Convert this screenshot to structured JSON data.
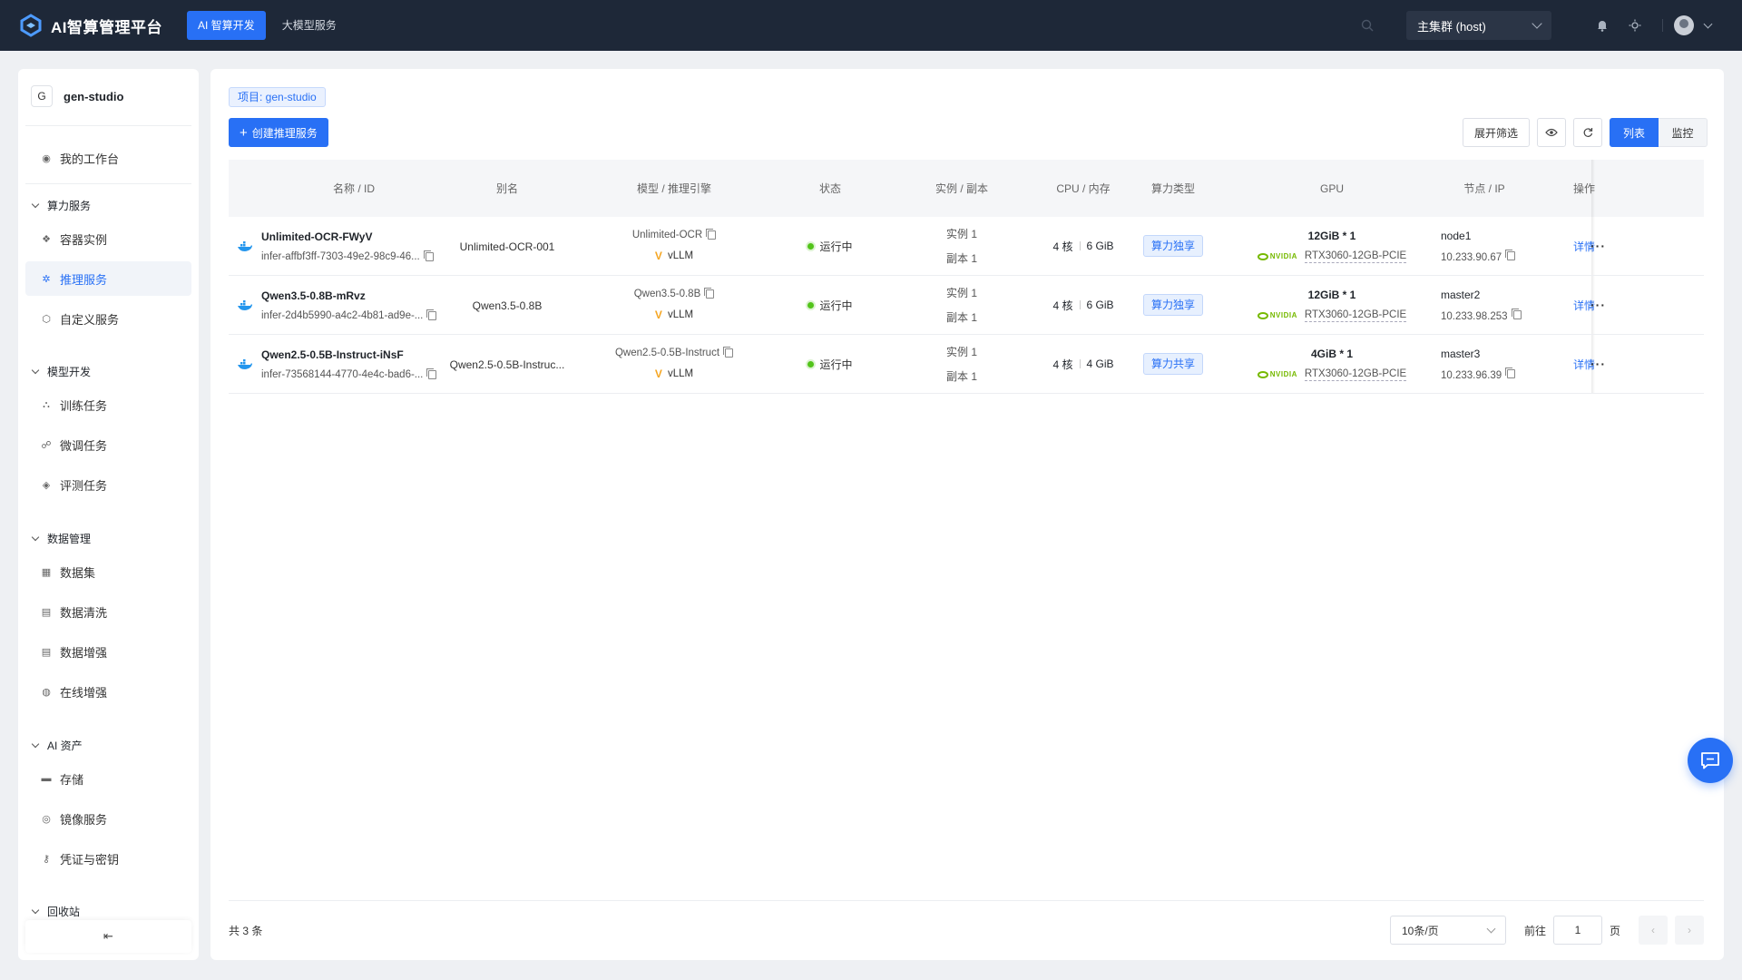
{
  "app": {
    "title": "AI智算管理平台"
  },
  "nav": {
    "tabs": [
      {
        "label": "AI 智算开发"
      },
      {
        "label": "大模型服务"
      }
    ]
  },
  "topbar": {
    "cluster": "主集群 (host)"
  },
  "sidebar": {
    "project_initial": "G",
    "project_name": "gen-studio",
    "workspace": "我的工作台",
    "groups": {
      "compute": "算力服务",
      "model_dev": "模型开发",
      "data": "数据管理",
      "ai_assets": "AI 资产",
      "recycle": "回收站"
    },
    "items": {
      "container": "容器实例",
      "inference": "推理服务",
      "custom": "自定义服务",
      "training": "训练任务",
      "finetune": "微调任务",
      "eval": "评测任务",
      "dataset": "数据集",
      "cleaning": "数据清洗",
      "augment": "数据增强",
      "online_augment": "在线增强",
      "storage": "存储",
      "image": "镜像服务",
      "credential": "凭证与密钥"
    },
    "collapse_icon": "⇤"
  },
  "main": {
    "project_tag": "项目: gen-studio",
    "create_button": "创建推理服务",
    "filter_button": "展开筛选",
    "view_list": "列表",
    "view_monitor": "监控"
  },
  "table": {
    "headers": {
      "name": "名称 / ID",
      "alias": "别名",
      "model": "模型 / 推理引擎",
      "status": "状态",
      "instance": "实例 / 副本",
      "cpu": "CPU / 内存",
      "compute_type": "算力类型",
      "gpu": "GPU",
      "node": "节点 / IP",
      "ops": "操作"
    },
    "rows": [
      {
        "name": "Unlimited-OCR-FWyV",
        "id": "infer-affbf3ff-7303-49e2-98c9-46...",
        "alias": "Unlimited-OCR-001",
        "model": "Unlimited-OCR",
        "engine": "vLLM",
        "status": "运行中",
        "instance": "实例 1",
        "replica": "副本 1",
        "cpu": "4 核",
        "mem": "6 GiB",
        "compute_type": "算力独享",
        "gpu_mem": "12GiB * 1",
        "gpu_model": "RTX3060-12GB-PCIE",
        "node": "node1",
        "ip": "10.233.90.67",
        "detail": "详情"
      },
      {
        "name": "Qwen3.5-0.8B-mRvz",
        "id": "infer-2d4b5990-a4c2-4b81-ad9e-...",
        "alias": "Qwen3.5-0.8B",
        "model": "Qwen3.5-0.8B",
        "engine": "vLLM",
        "status": "运行中",
        "instance": "实例 1",
        "replica": "副本 1",
        "cpu": "4 核",
        "mem": "6 GiB",
        "compute_type": "算力独享",
        "gpu_mem": "12GiB * 1",
        "gpu_model": "RTX3060-12GB-PCIE",
        "node": "master2",
        "ip": "10.233.98.253",
        "detail": "详情"
      },
      {
        "name": "Qwen2.5-0.5B-Instruct-iNsF",
        "id": "infer-73568144-4770-4e4c-bad6-...",
        "alias": "Qwen2.5-0.5B-Instruc...",
        "model": "Qwen2.5-0.5B-Instruct",
        "engine": "vLLM",
        "status": "运行中",
        "instance": "实例 1",
        "replica": "副本 1",
        "cpu": "4 核",
        "mem": "4 GiB",
        "compute_type": "算力共享",
        "gpu_mem": "4GiB * 1",
        "gpu_model": "RTX3060-12GB-PCIE",
        "node": "master3",
        "ip": "10.233.96.39",
        "detail": "详情"
      }
    ],
    "nvidia_label": "NVIDIA",
    "engine_logo": "V",
    "more_label": "···"
  },
  "footer": {
    "total": "共 3 条",
    "page_size": "10条/页",
    "goto_prefix": "前往",
    "page": "1",
    "goto_suffix": "页",
    "prev_icon": "‹",
    "next_icon": "›"
  },
  "colors": {
    "topbar": "#1e2838",
    "accent": "#2870f5",
    "status_running": "#52c41a",
    "nvidia": "#76b900"
  }
}
